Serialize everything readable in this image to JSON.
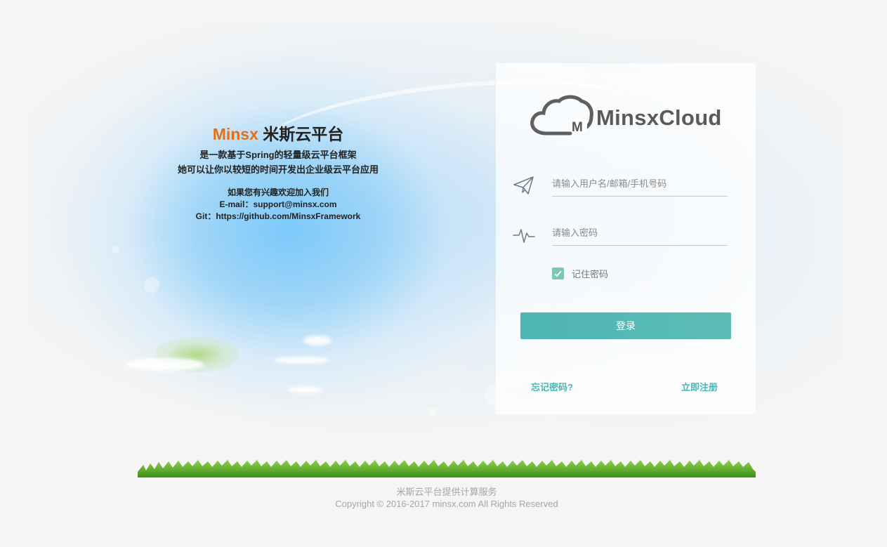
{
  "intro": {
    "brand": "Minsx",
    "title": "米斯云平台",
    "desc_line1": "是一款基于Spring的轻量级云平台框架",
    "desc_line2": "她可以让你以较短的时间开发出企业级云平台应用",
    "contact_line1": "如果您有兴趣欢迎加入我们",
    "email_line": "E-mail：support@minsx.com",
    "git_line": "Git：https://github.com/MinsxFramework"
  },
  "login": {
    "logo_text": "MinsxCloud",
    "logo_badge": "M",
    "username": {
      "placeholder": "请输入用户名/邮箱/手机号码",
      "value": "",
      "icon": "paper-plane-icon"
    },
    "password": {
      "placeholder": "请输入密码",
      "value": "",
      "icon": "pulse-icon"
    },
    "remember_label": "记住密码",
    "remember_checked": true,
    "submit_label": "登录",
    "forgot_label": "忘记密码?",
    "register_label": "立即注册"
  },
  "footer": {
    "line1": "米斯云平台提供计算服务",
    "line2": "Copyright © 2016-2017 minsx.com All Rights Reserved"
  },
  "colors": {
    "brand_orange": "#e46f18",
    "accent_teal": "#4db5b3",
    "checkbox": "#7bc9b4",
    "link": "#4bb6b3"
  }
}
